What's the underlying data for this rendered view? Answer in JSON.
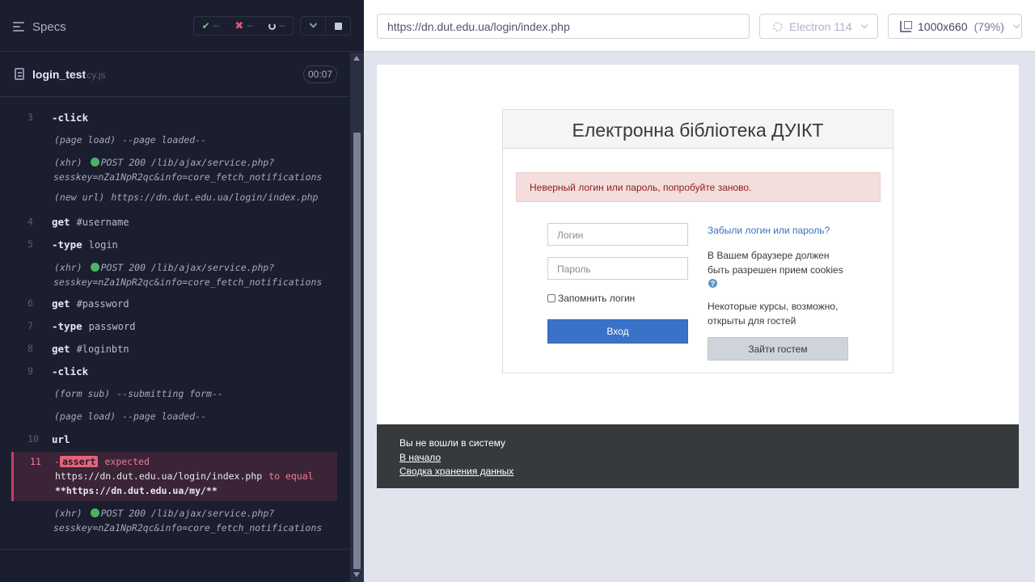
{
  "reporter": {
    "specs_label": "Specs",
    "stats": {
      "passed": "--",
      "failed": "--",
      "pending": "--"
    },
    "spec_name": "login_test",
    "spec_ext": ".cy.js",
    "duration": "00:07",
    "commands": [
      {
        "num": "3",
        "name": "click",
        "dash": "-",
        "arg": ""
      },
      {
        "evt": "(page load)",
        "msg": "--page loaded--"
      },
      {
        "evt": "(xhr)",
        "msg": "POST 200 /lib/ajax/service.php?",
        "line2": "sesskey=nZa1NpR2qc&info=core_fetch_notifications"
      },
      {
        "evt": "(new url)",
        "msg": "https://dn.dut.edu.ua/login/index.php"
      },
      {
        "num": "4",
        "name": "get",
        "dash": "",
        "arg": "#username"
      },
      {
        "num": "5",
        "name": "type",
        "dash": "-",
        "arg": "login"
      },
      {
        "evt": "(xhr)",
        "msg": "POST 200 /lib/ajax/service.php?",
        "line2": "sesskey=nZa1NpR2qc&info=core_fetch_notifications"
      },
      {
        "num": "6",
        "name": "get",
        "dash": "",
        "arg": "#password"
      },
      {
        "num": "7",
        "name": "type",
        "dash": "-",
        "arg": "password"
      },
      {
        "num": "8",
        "name": "get",
        "dash": "",
        "arg": "#loginbtn"
      },
      {
        "num": "9",
        "name": "click",
        "dash": "-",
        "arg": ""
      },
      {
        "evt": "(form sub)",
        "msg": "--submitting form--"
      },
      {
        "evt": "(page load)",
        "msg": "--page loaded--"
      },
      {
        "num": "10",
        "name": "url",
        "dash": "",
        "arg": ""
      }
    ],
    "assert": {
      "num": "11",
      "badge": "assert",
      "expected": "expected",
      "actual": "https://dn.dut.edu.ua/login/index.php",
      "to_equal": "to equal",
      "target": "**https://dn.dut.edu.ua/my/**"
    },
    "last_xhr": {
      "evt": "(xhr)",
      "msg": "POST 200 /lib/ajax/service.php?",
      "line2": "sesskey=nZa1NpR2qc&info=core_fetch_notifications"
    }
  },
  "aut": {
    "url": "https://dn.dut.edu.ua/login/index.php",
    "browser": "Electron 114",
    "viewport": "1000x660",
    "zoom": "(79%)"
  },
  "page": {
    "title": "Електронна бібліотека ДУІКТ",
    "alert": "Неверный логин или пароль, попробуйте заново.",
    "username_placeholder": "Логин",
    "password_placeholder": "Пароль",
    "remember_label": "Запомнить логин",
    "login_button": "Вход",
    "forgot_link": "Забыли логин или пароль?",
    "cookies_line1": "В Вашем браузере должен",
    "cookies_line2": "быть разрешен прием cookies",
    "guest_line1": "Некоторые курсы, возможно,",
    "guest_line2": "открыты для гостей",
    "guest_button": "Зайти гостем",
    "footer": {
      "status": "Вы не вошли в систему",
      "home_link": "В начало",
      "policy_link": "Сводка хранения данных"
    }
  },
  "colors": {
    "reporter_bg": "#1b1e2e",
    "fail_accent": "#c4426a",
    "pass_dot": "#48b566",
    "login_button": "#3a72c8",
    "footer_bg": "#373a3c",
    "alert_bg": "#f3dedd"
  }
}
